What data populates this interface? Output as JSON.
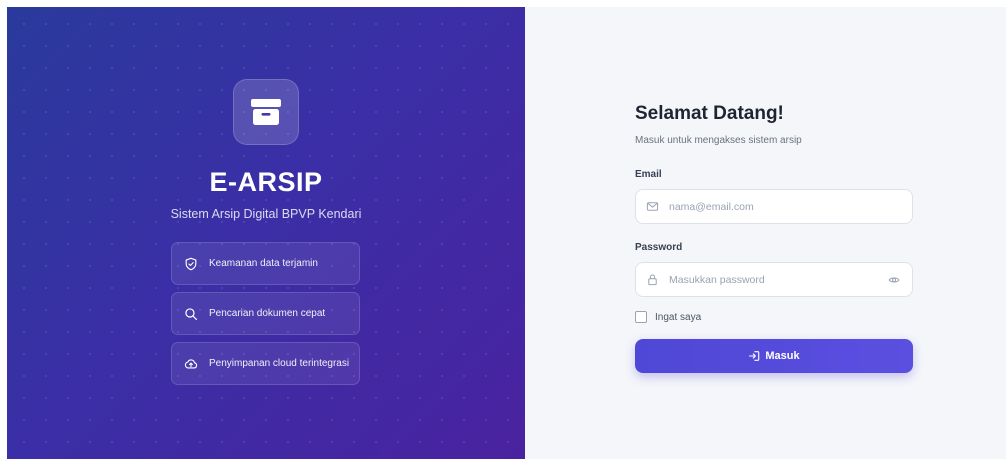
{
  "brand": {
    "logo_icon": "archive-box-icon",
    "title": "E-ARSIP",
    "subtitle": "Sistem Arsip Digital BPVP Kendari"
  },
  "features": [
    {
      "icon": "shield-check-icon",
      "label": "Keamanan data terjamin"
    },
    {
      "icon": "search-icon",
      "label": "Pencarian dokumen cepat"
    },
    {
      "icon": "cloud-upload-icon",
      "label": "Penyimpanan cloud terintegrasi"
    }
  ],
  "login": {
    "heading": "Selamat Datang!",
    "subheading": "Masuk untuk mengakses sistem arsip",
    "email": {
      "label": "Email",
      "placeholder": "nama@email.com",
      "value": "",
      "icon": "mail-icon"
    },
    "password": {
      "label": "Password",
      "placeholder": "Masukkan password",
      "value": "",
      "icon": "lock-icon",
      "toggle_icon": "eye-icon"
    },
    "remember": {
      "label": "Ingat saya",
      "checked": false
    },
    "submit": {
      "label": "Masuk",
      "icon": "login-icon"
    }
  },
  "colors": {
    "panel_gradient_start": "#2a3a9c",
    "panel_gradient_end": "#4a22a0",
    "accent": "#5b4fe0",
    "right_background": "#f4f6fa"
  }
}
